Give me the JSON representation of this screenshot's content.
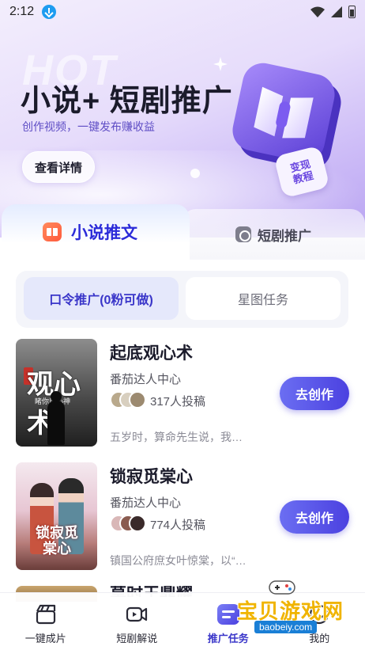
{
  "status_bar": {
    "time": "2:12"
  },
  "hero": {
    "bg_text": "HOT",
    "title": "小说+ 短剧推广",
    "subtitle": "创作视频，一键发布赚收益",
    "detail_button": "查看详情",
    "badge_line1": "变现",
    "badge_line2": "教程",
    "accent": "#8b5cf6"
  },
  "tabs": [
    {
      "label": "小说推文",
      "icon": "book-icon",
      "active": true
    },
    {
      "label": "短剧推广",
      "icon": "film-icon",
      "active": false
    }
  ],
  "subtabs": [
    {
      "label": "口令推广(0粉可做)",
      "active": true
    },
    {
      "label": "星图任务",
      "active": false
    }
  ],
  "items": [
    {
      "title": "起底观心术",
      "source": "番茄达人中心",
      "count": "317人投稿",
      "desc": "五岁时，算命先生说，我…",
      "button": "去创作",
      "cover_text": "观心术",
      "cover_sub": "睹你目心神"
    },
    {
      "title": "锁寂觅棠心",
      "source": "番茄达人中心",
      "count": "774人投稿",
      "desc": "镇国公府庶女叶惊棠，以“…",
      "button": "去创作",
      "cover_text": "锁寂觅棠心"
    },
    {
      "title": "莫时王鼎耀",
      "partial": true
    }
  ],
  "bottom_nav": [
    {
      "label": "一键成片",
      "icon": "clapperboard-icon",
      "active": false
    },
    {
      "label": "短剧解说",
      "icon": "video-camera-icon",
      "active": false
    },
    {
      "label": "推广任务",
      "icon": "task-icon",
      "active": true
    },
    {
      "label": "我的",
      "icon": "smile-icon",
      "active": false
    }
  ],
  "watermark": {
    "text": "宝贝游戏网",
    "url": "baobeiy.com"
  },
  "colors": {
    "primary": "#4b41e0",
    "tab_active": "#2b2bd9"
  }
}
